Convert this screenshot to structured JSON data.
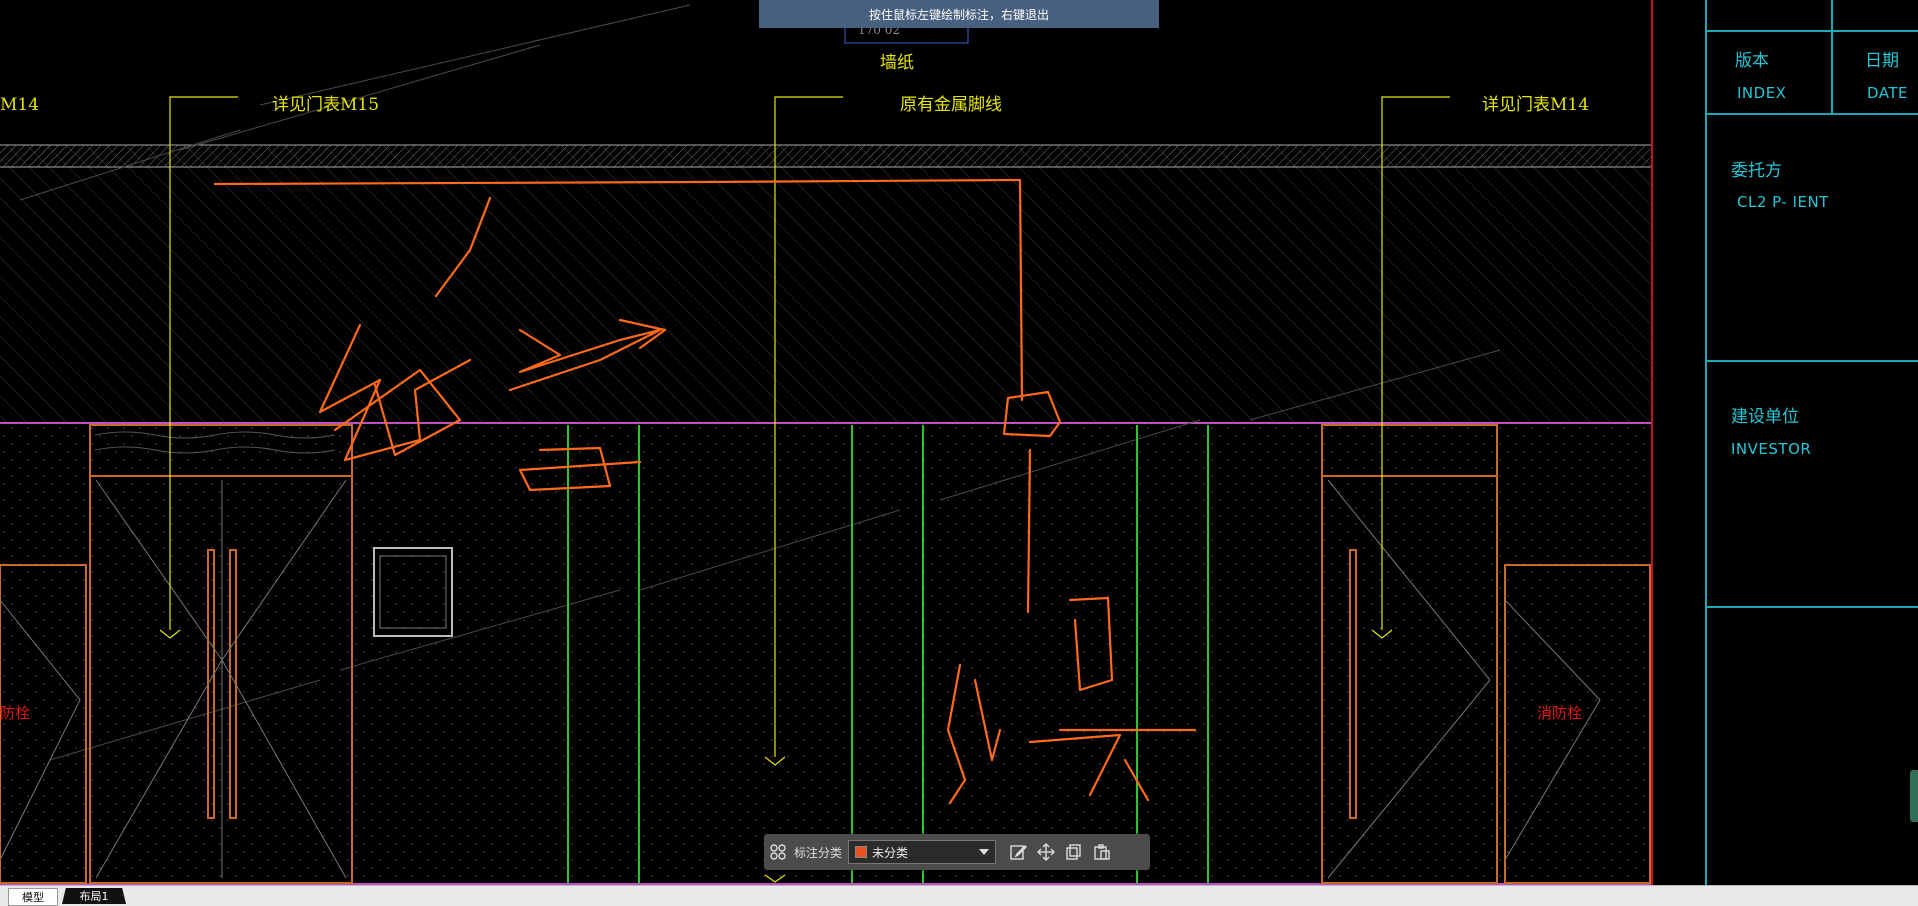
{
  "hint": "按住鼠标左键绘制标注，右键退出",
  "drawing_labels": {
    "top_small": "170 02",
    "wallpaper": "墙纸",
    "door_m15": "详见门表M15",
    "metal_skirting": "原有金属脚线",
    "door_m14_right": "详见门表M14",
    "door_m14_left": "M14",
    "fire_hydrant_left": "防栓",
    "fire_hydrant_right": "消防栓"
  },
  "title_block": {
    "version_zh": "版本",
    "version_en": "INDEX",
    "date_zh": "日期",
    "date_en": "DATE",
    "client_zh": "委托方",
    "client_en": "CL2 P- IENT",
    "investor_zh": "建设单位",
    "investor_en": "INVESTOR"
  },
  "toolbar": {
    "category_label": "标注分类",
    "category_value": "未分类",
    "category_color": "#e8531f",
    "icons": [
      "grid-icon",
      "edit-icon",
      "move-icon",
      "copy-icon",
      "paste-icon"
    ]
  },
  "tabs": {
    "model": "模型",
    "layout": "布局1"
  },
  "colors": {
    "annotation_orange": "#ff6a1a",
    "cad_yellow": "#e6e600",
    "cad_green": "#28c828",
    "cad_magenta": "#d040d0",
    "title_cyan": "#26c6d6"
  }
}
